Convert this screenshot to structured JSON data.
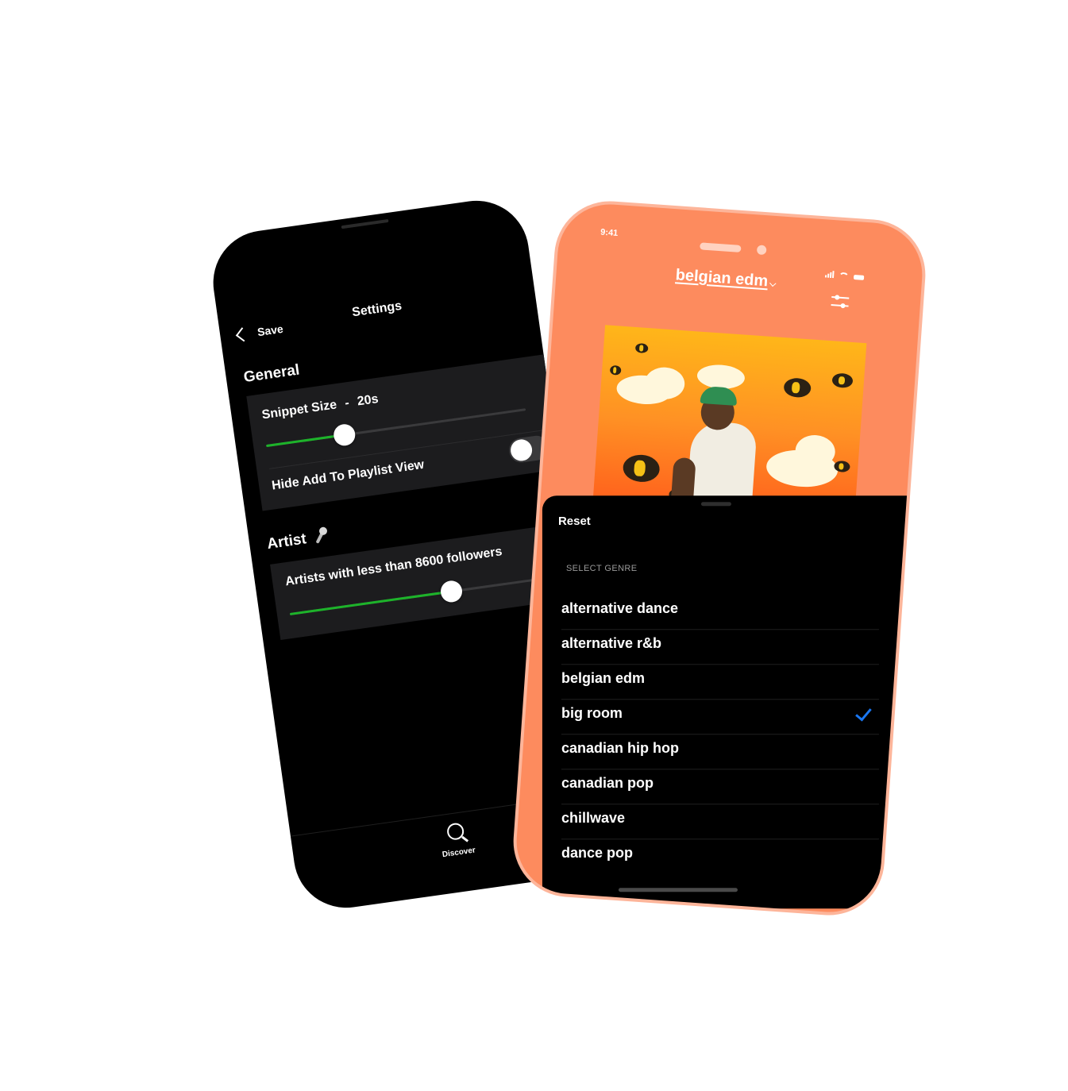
{
  "settings_screen": {
    "nav": {
      "back_label": "Save",
      "title": "Settings"
    },
    "general": {
      "title": "General",
      "snippet_label": "Snippet Size",
      "snippet_separator": "-",
      "snippet_value": "20s",
      "snippet_slider_fraction": 0.3,
      "hide_add_label": "Hide Add To Playlist View",
      "hide_add_on": false
    },
    "artist": {
      "title": "Artist",
      "title_icon": "microphone-icon",
      "followers_label": "Artists with less than 8600 followers",
      "followers_slider_fraction": 0.62
    },
    "tab_bar": {
      "discover_label": "Discover",
      "discover_icon": "search-icon"
    }
  },
  "discover_screen": {
    "status_time": "9:41",
    "genre_title": "belgian edm",
    "sheet": {
      "reset_label": "Reset",
      "section_label": "SELECT GENRE",
      "genres": [
        {
          "name": "alternative dance",
          "checked": false
        },
        {
          "name": "alternative r&b",
          "checked": false
        },
        {
          "name": "belgian edm",
          "checked": false
        },
        {
          "name": "big room",
          "checked": true
        },
        {
          "name": "canadian hip hop",
          "checked": false
        },
        {
          "name": "canadian pop",
          "checked": false
        },
        {
          "name": "chillwave",
          "checked": false
        },
        {
          "name": "dance pop",
          "checked": false
        }
      ]
    }
  },
  "colors": {
    "accent_green": "#1db32a",
    "phone_orange": "#fd8b5e",
    "check_blue": "#1a77f2"
  }
}
